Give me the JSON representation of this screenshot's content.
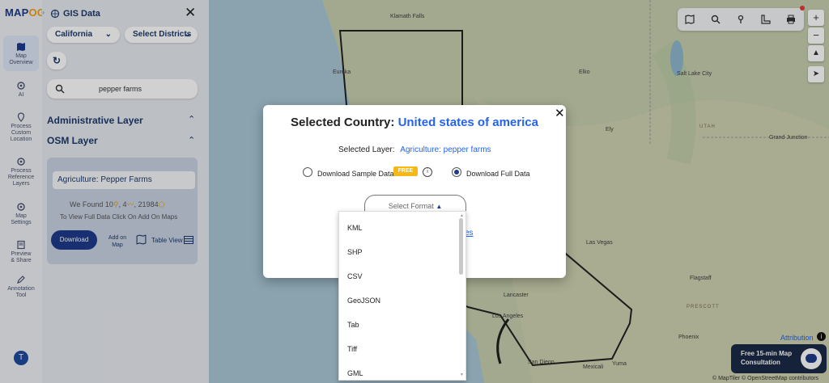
{
  "rail": {
    "items": [
      {
        "label_1": "Map",
        "label_2": "Overview",
        "active": true
      },
      {
        "label_1": "AI",
        "label_2": ""
      },
      {
        "label_1": "Process",
        "label_2": "Custom",
        "label_3": "Location"
      },
      {
        "label_1": "Process",
        "label_2": "Reference",
        "label_3": "Layers"
      },
      {
        "label_1": "Map",
        "label_2": "Settings"
      },
      {
        "label_1": "Preview",
        "label_2": "& Share"
      },
      {
        "label_1": "Annotation",
        "label_2": "Tool"
      }
    ],
    "avatar": "T"
  },
  "panel": {
    "title": "GIS Data",
    "state_select": "California",
    "district_select": "Select Districts",
    "search_value": "pepper farms",
    "admin_layer": "Administrative Layer",
    "osm_layer": "OSM Layer",
    "layer_name": "Agriculture: Pepper Farms",
    "found_prefix": "We Found",
    "found_a": "10",
    "found_b": "4",
    "found_c": "21984",
    "full_data_note": "To View Full Data Click On Add On Maps",
    "download": "Download",
    "add_on_map_1": "Add on",
    "add_on_map_2": "Map",
    "table_view": "Table View"
  },
  "map": {
    "cities": [
      {
        "name": "Klamath Falls"
      },
      {
        "name": "Eureka"
      },
      {
        "name": "Elko"
      },
      {
        "name": "Salt Lake City"
      },
      {
        "name": "Ely"
      },
      {
        "name": "UTAH"
      },
      {
        "name": "Grand Junction"
      },
      {
        "name": "Las Vegas"
      },
      {
        "name": "Flagstaff"
      },
      {
        "name": "Lancaster"
      },
      {
        "name": "Los Angeles"
      },
      {
        "name": "PRESCOTT"
      },
      {
        "name": "Phoenix"
      },
      {
        "name": "San Diego"
      },
      {
        "name": "Mexicali"
      },
      {
        "name": "Yuma"
      }
    ],
    "attribution_link": "Attribution",
    "attribution_text": "© MapTiler © OpenStreetMap contributors",
    "consult_1": "Free 15-min Map",
    "consult_2": "Consultation",
    "zoom_in": "+",
    "zoom_out": "−"
  },
  "modal": {
    "title_prefix": "Selected Country:",
    "country": "United states of america",
    "layer_label": "Selected Layer:",
    "layer_value": "Agriculture: pepper farms",
    "sample_option": "Download Sample Data",
    "free_badge": "FREE",
    "full_option": "Download Full Data",
    "full_selected": true,
    "format_placeholder": "Select Format",
    "hidden_link_tail": "es",
    "formats": [
      "KML",
      "SHP",
      "CSV",
      "GeoJSON",
      "Tab",
      "Tiff",
      "GML"
    ]
  },
  "colors": {
    "brand": "#1e3a8a",
    "accent": "#2563eb",
    "badge": "#f5b915"
  }
}
